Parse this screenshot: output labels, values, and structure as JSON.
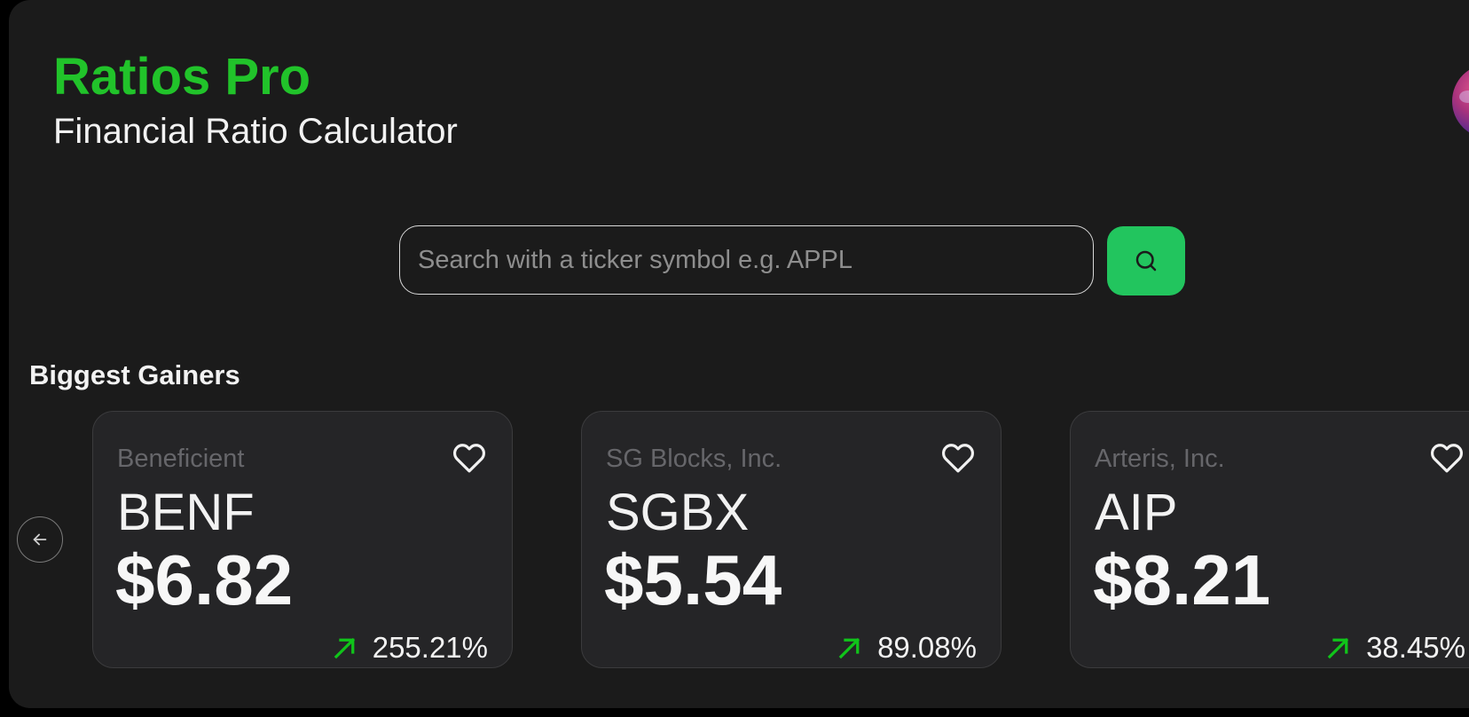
{
  "header": {
    "title": "Ratios Pro",
    "subtitle": "Financial Ratio Calculator"
  },
  "search": {
    "placeholder": "Search with a ticker symbol e.g. APPL",
    "value": "",
    "button_icon": "search-icon"
  },
  "gainers": {
    "title": "Biggest Gainers",
    "prev_icon": "arrow-left-icon",
    "cards": [
      {
        "name": "Beneficient",
        "symbol": "BENF",
        "price": "$6.82",
        "change": "255.21%",
        "favorite_icon": "heart-outline-icon",
        "trend_icon": "arrow-up-right-icon"
      },
      {
        "name": "SG Blocks, Inc.",
        "symbol": "SGBX",
        "price": "$5.54",
        "change": "89.08%",
        "favorite_icon": "heart-outline-icon",
        "trend_icon": "arrow-up-right-icon"
      },
      {
        "name": "Arteris, Inc.",
        "symbol": "AIP",
        "price": "$8.21",
        "change": "38.45%",
        "favorite_icon": "heart-outline-icon",
        "trend_icon": "arrow-up-right-icon"
      }
    ]
  },
  "colors": {
    "background": "#1b1b1b",
    "brand_green": "#21c32a",
    "button_green": "#22c55e",
    "card_background": "#252527",
    "trend_up": "#10c41a"
  }
}
